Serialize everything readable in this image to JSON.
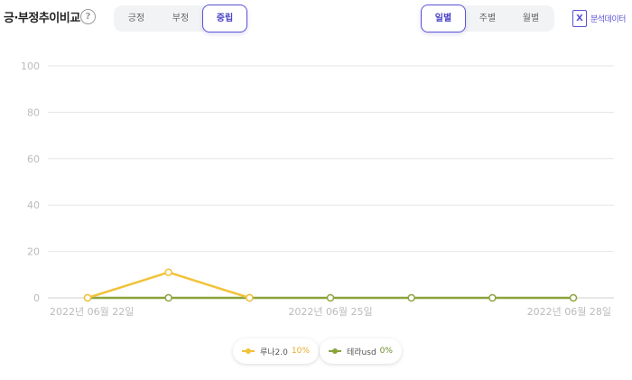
{
  "header": {
    "title": "긍·부정추이비교",
    "help_icon": "?"
  },
  "sentiment_tabs": [
    {
      "label": "긍정",
      "active": false
    },
    {
      "label": "부정",
      "active": false
    },
    {
      "label": "중립",
      "active": true
    }
  ],
  "period_tabs": [
    {
      "label": "일별",
      "active": true
    },
    {
      "label": "주별",
      "active": false
    },
    {
      "label": "월별",
      "active": false
    }
  ],
  "export": {
    "icon": "excel-icon",
    "label": "분석데이터"
  },
  "colors": {
    "accent": "#5b53d6",
    "series1": "#f2c23a",
    "series2": "#8aa33c",
    "grid": "#e5e5e5"
  },
  "chart_data": {
    "type": "line",
    "x": [
      "2022-06-22",
      "2022-06-23",
      "2022-06-24",
      "2022-06-25",
      "2022-06-26",
      "2022-06-27",
      "2022-06-28"
    ],
    "x_tick_labels": [
      "2022년 06월 22일",
      "",
      "",
      "2022년 06월 25일",
      "",
      "",
      "2022년 06월 28일"
    ],
    "ylim": [
      0,
      100
    ],
    "yticks": [
      0,
      20,
      40,
      60,
      80,
      100
    ],
    "grid": true,
    "legend_position": "bottom",
    "series": [
      {
        "name": "루나2.0",
        "share": "10%",
        "color": "#f2c23a",
        "values": [
          0,
          11,
          0,
          null,
          null,
          null,
          null
        ]
      },
      {
        "name": "테라usd",
        "share": "0%",
        "color": "#8aa33c",
        "values": [
          0,
          0,
          0,
          0,
          0,
          0,
          0
        ]
      }
    ]
  }
}
